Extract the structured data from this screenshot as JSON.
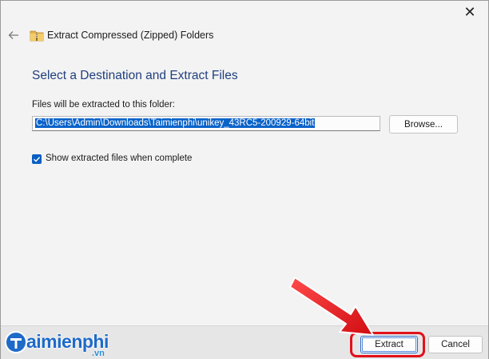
{
  "window": {
    "title": "Extract Compressed (Zipped) Folders",
    "close_glyph": "✕"
  },
  "content": {
    "heading": "Select a Destination and Extract Files",
    "destination_label": "Files will be extracted to this folder:",
    "destination_path": "C:\\Users\\Admin\\Downloads\\Taimienphi\\unikey_43RC5-200929-64bit",
    "browse_label": "Browse...",
    "show_files_label": "Show extracted files when complete",
    "show_files_checked": true
  },
  "footer": {
    "extract_label": "Extract",
    "cancel_label": "Cancel"
  },
  "watermark": {
    "brand": "aimienphi",
    "suffix": ".vn"
  },
  "colors": {
    "accent": "#0a5fc2",
    "heading": "#1f3f7d",
    "annotation": "#e2111a"
  }
}
